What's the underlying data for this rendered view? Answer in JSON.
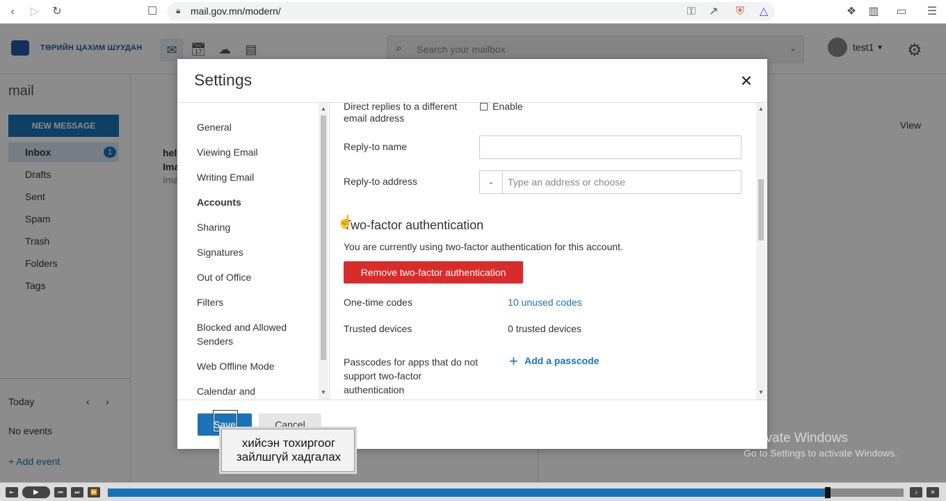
{
  "browser": {
    "url": "mail.gov.mn/modern/"
  },
  "app": {
    "logo_text": "ТӨРИЙН ЦАХИМ ШУУДАН",
    "search_placeholder": "Search your mailbox",
    "user_name": "test1",
    "section_title": "mail",
    "new_message_label": "NEW MESSAGE",
    "folders": [
      {
        "label": "Inbox",
        "count": "1"
      },
      {
        "label": "Drafts"
      },
      {
        "label": "Sent"
      },
      {
        "label": "Spam"
      },
      {
        "label": "Trash"
      },
      {
        "label": "Folders"
      },
      {
        "label": "Tags"
      }
    ],
    "calendar": {
      "today_label": "Today",
      "no_events": "No events",
      "add_event": "Add event"
    },
    "message_preview": {
      "sender": "hel",
      "subject": "Ima",
      "snippet": "Ima"
    },
    "view_label": "View"
  },
  "settings": {
    "title": "Settings",
    "nav": [
      {
        "label": "General"
      },
      {
        "label": "Viewing Email"
      },
      {
        "label": "Writing Email"
      },
      {
        "label": "Accounts",
        "active": true
      },
      {
        "label": "Sharing"
      },
      {
        "label": "Signatures"
      },
      {
        "label": "Out of Office"
      },
      {
        "label": "Filters"
      },
      {
        "label": "Blocked and Allowed"
      },
      {
        "label": "Senders"
      },
      {
        "label": "Web Offline Mode"
      },
      {
        "label": "Calendar and"
      }
    ],
    "direct_replies_label_line1": "Direct replies to a different",
    "direct_replies_label_line2": "email address",
    "enable_label": "Enable",
    "reply_to_name_label": "Reply-to name",
    "reply_to_name_value": "",
    "reply_to_address_label": "Reply-to address",
    "reply_to_address_placeholder": "Type an address or choose",
    "two_factor": {
      "title": "Two-factor authentication",
      "status": "You are currently using two-factor authentication for this account.",
      "remove_button": "Remove two-factor authentication",
      "one_time_codes_label": "One-time codes",
      "one_time_codes_link": "10 unused codes",
      "trusted_devices_label": "Trusted devices",
      "trusted_devices_value": "0 trusted devices",
      "passcodes_label_line1": "Passcodes for apps that do not",
      "passcodes_label_line2": "support two-factor",
      "passcodes_label_line3": "authentication",
      "add_passcode_link": "Add a passcode"
    },
    "save_label": "Save",
    "cancel_label": "Cancel"
  },
  "tooltip": {
    "line1": "хийсэн тохиргоог",
    "line2": "зайлшгүй хадгалах"
  },
  "watermark": {
    "line1": "Activate Windows",
    "line2": "Go to Settings to activate Windows."
  },
  "media": {
    "progress": 0.905
  }
}
